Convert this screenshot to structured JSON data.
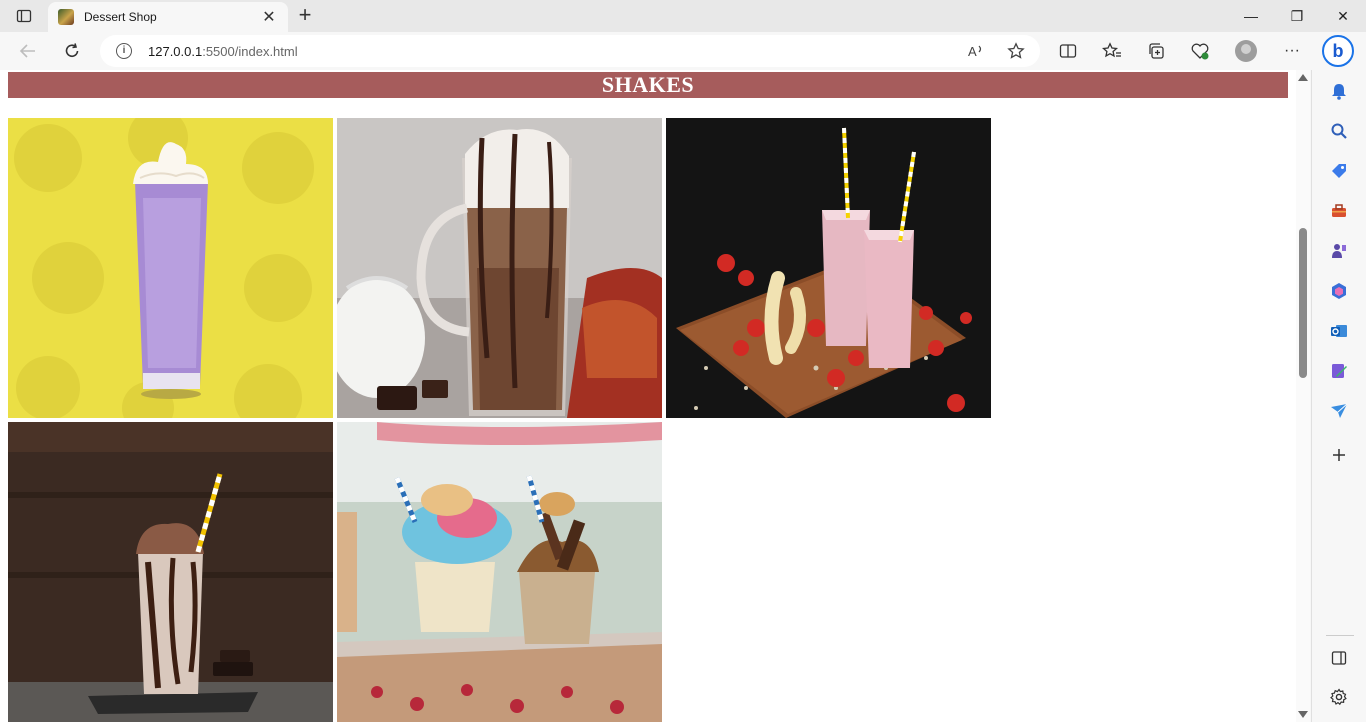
{
  "browser": {
    "tab_title": "Dessert Shop",
    "url_host": "127.0.0.1",
    "url_path": ":5500/index.html",
    "tab_close_glyph": "✕",
    "new_tab_glyph": "+",
    "minimize_glyph": "—",
    "restore_glyph": "❐",
    "close_glyph": "✕",
    "more_glyph": "···",
    "bing_glyph": "b"
  },
  "page": {
    "section_title": "SHAKES",
    "images": [
      {
        "name": "purple-shake-image",
        "desc": "purple milkshake with whipped cream on yellow background"
      },
      {
        "name": "chocolate-coffee-shake-image",
        "desc": "chocolate coffee shake in glass mug"
      },
      {
        "name": "strawberry-banana-smoothie-image",
        "desc": "two strawberry smoothies with straws on wooden board"
      },
      {
        "name": "chocolate-milkshake-image",
        "desc": "chocolate milkshake with straw"
      },
      {
        "name": "freakshakes-image",
        "desc": "two loaded freakshakes with cotton candy"
      }
    ]
  },
  "sidebar": {
    "items": [
      "bell-icon",
      "search-icon",
      "tag-icon",
      "toolbox-icon",
      "games-icon",
      "office-icon",
      "outlook-icon",
      "designer-icon",
      "send-icon",
      "add-icon"
    ],
    "bottom": [
      "sidebar-toggle-icon",
      "settings-icon"
    ]
  },
  "colors": {
    "header_bg": "#a65c5c",
    "header_text": "#ffffff"
  }
}
